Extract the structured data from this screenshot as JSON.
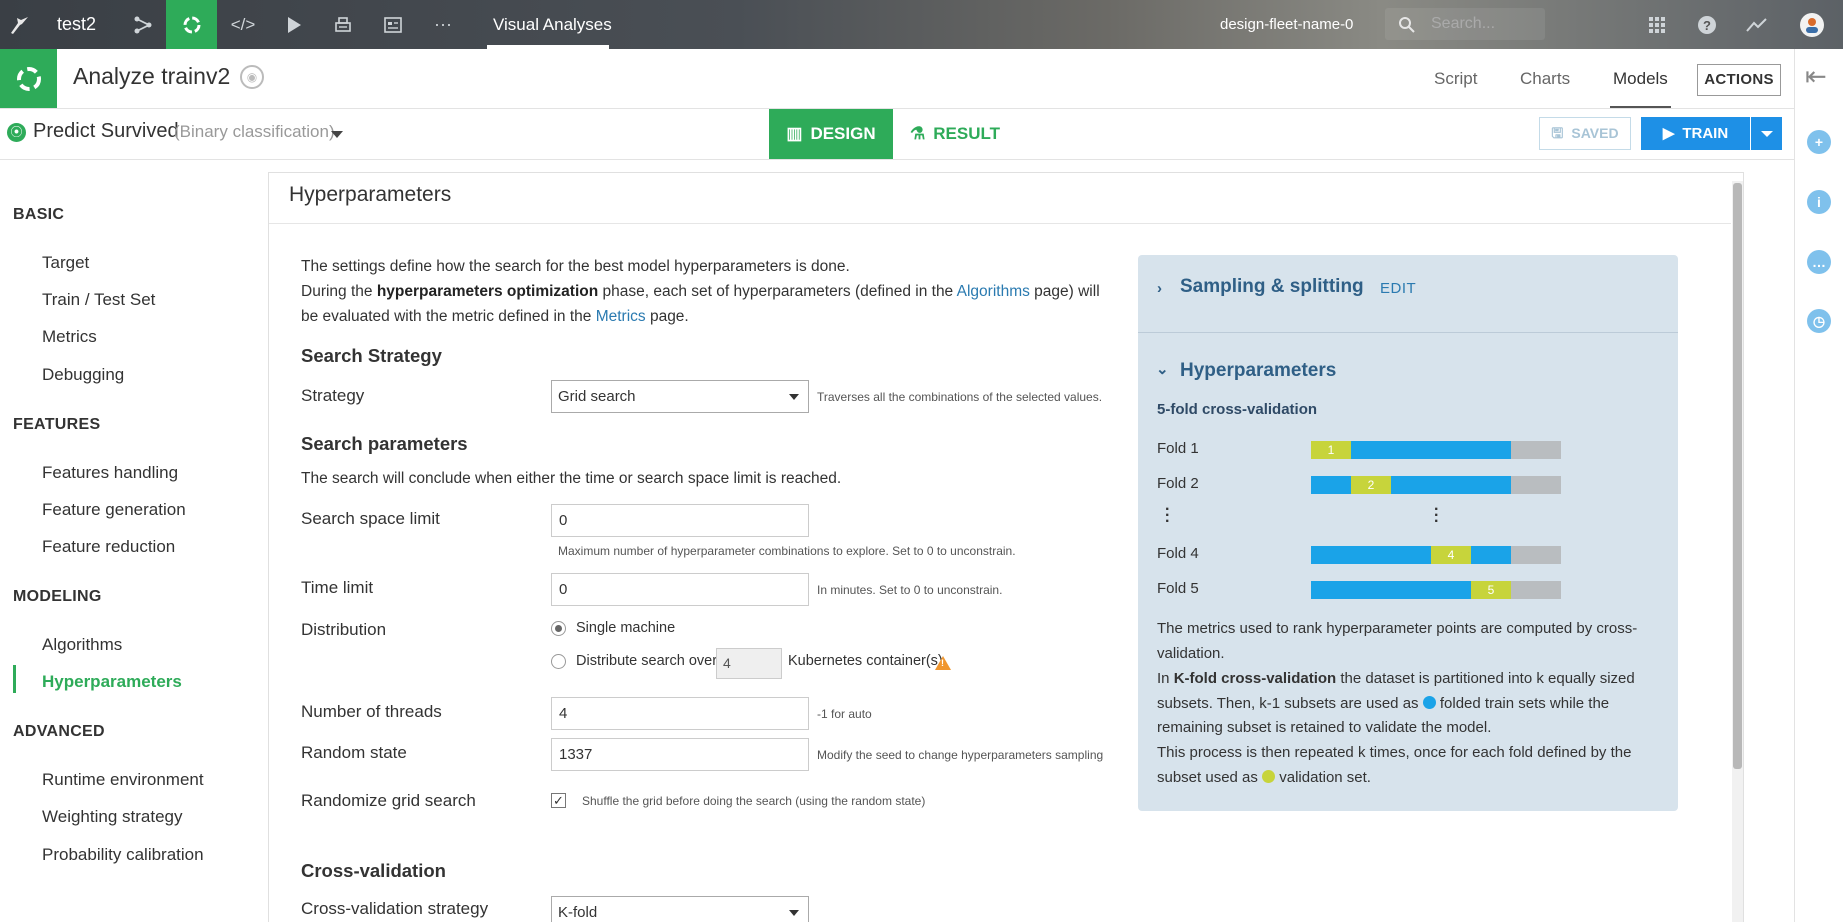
{
  "topnav": {
    "project": "test2",
    "section": "Visual Analyses",
    "instance": "design-fleet-name-0",
    "search_placeholder": "Search..."
  },
  "header": {
    "title": "Analyze trainv2",
    "tabs": [
      "Script",
      "Charts",
      "Models"
    ],
    "active_tab": "Models",
    "actions_label": "ACTIONS"
  },
  "task": {
    "title": "Predict Survived",
    "subtitle": "(Binary classification)",
    "design_label": "DESIGN",
    "result_label": "RESULT",
    "saved_label": "SAVED",
    "train_label": "TRAIN"
  },
  "sidebar": {
    "sections": [
      {
        "title": "BASIC",
        "items": [
          "Target",
          "Train / Test Set",
          "Metrics",
          "Debugging"
        ]
      },
      {
        "title": "FEATURES",
        "items": [
          "Features handling",
          "Feature generation",
          "Feature reduction"
        ]
      },
      {
        "title": "MODELING",
        "items": [
          "Algorithms",
          "Hyperparameters"
        ]
      },
      {
        "title": "ADVANCED",
        "items": [
          "Runtime environment",
          "Weighting strategy",
          "Probability calibration"
        ]
      }
    ],
    "active_item": "Hyperparameters"
  },
  "panel": {
    "title": "Hyperparameters",
    "intro_line1": "The settings define how the search for the best model hyperparameters is done.",
    "intro_line2_a": "During the ",
    "intro_line2_b": "hyperparameters optimization",
    "intro_line2_c": " phase, each set of hyperparameters (defined in the ",
    "intro_line2_link": "Algorithms",
    "intro_line2_d": " page) will",
    "intro_line3_a": "be evaluated with the metric defined in the ",
    "intro_line3_link": "Metrics",
    "intro_line3_b": " page.",
    "search_strategy_heading": "Search Strategy",
    "strategy_label": "Strategy",
    "strategy_value": "Grid search",
    "strategy_hint": "Traverses all the combinations of the selected values.",
    "search_params_heading": "Search parameters",
    "search_params_desc": "The search will conclude when either the time or search space limit is reached.",
    "space_limit_label": "Search space limit",
    "space_limit_value": "0",
    "space_limit_hint": "Maximum number of hyperparameter combinations to explore. Set to 0 to unconstrain.",
    "time_limit_label": "Time limit",
    "time_limit_value": "0",
    "time_limit_hint": "In minutes. Set to 0 to unconstrain.",
    "distribution_label": "Distribution",
    "dist_single": "Single machine",
    "dist_multi_a": "Distribute search over",
    "dist_multi_value": "4",
    "dist_multi_b": "Kubernetes container(s)",
    "threads_label": "Number of threads",
    "threads_value": "4",
    "threads_hint": "-1 for auto",
    "random_state_label": "Random state",
    "random_state_value": "1337",
    "random_state_hint": "Modify the seed to change hyperparameters sampling",
    "randomize_label": "Randomize grid search",
    "randomize_hint": "Shuffle the grid before doing the search (using the random state)",
    "randomize_checked": true,
    "cv_heading": "Cross-validation",
    "cv_strategy_label": "Cross-validation strategy",
    "cv_strategy_value": "K-fold"
  },
  "info_card": {
    "sampling_title": "Sampling & splitting",
    "edit_label": "EDIT",
    "hyper_title": "Hyperparameters",
    "cv_subtitle": "5-fold cross-validation",
    "folds": [
      {
        "label": "Fold 1",
        "marker": "1"
      },
      {
        "label": "Fold 2",
        "marker": "2"
      },
      {
        "label": "Fold 4",
        "marker": "4"
      },
      {
        "label": "Fold 5",
        "marker": "5"
      }
    ],
    "text1": "The metrics used to rank hyperparameter points are computed by cross-validation.",
    "text2_a": "In ",
    "text2_b": "K-fold cross-validation",
    "text2_c": " the dataset is partitioned into k equally sized subsets. Then, k-1 subsets are used as ",
    "text2_d": " folded train sets while the remaining subset is retained to validate the model.",
    "text3_a": "This process is then repeated k times, once for each fold defined by the subset used as ",
    "text3_b": " validation set.",
    "colors": {
      "train": "#1aa3e8",
      "validation": "#c7d43b",
      "test": "#b9bdc0"
    }
  }
}
